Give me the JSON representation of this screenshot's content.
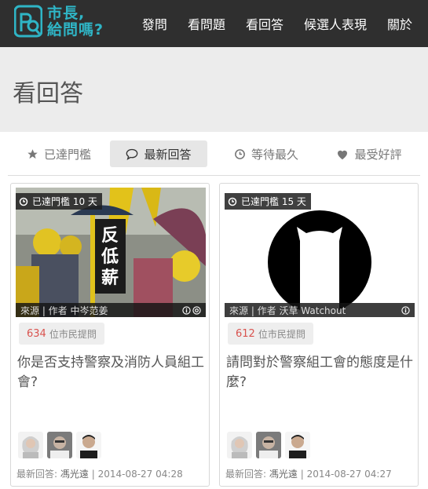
{
  "header": {
    "logo_line1": "市長,",
    "logo_line2": "給問嗎?",
    "nav": [
      "發問",
      "看問題",
      "看回答",
      "候選人表現",
      "關於"
    ]
  },
  "page_title": "看回答",
  "tabs": [
    {
      "label": "已達門檻",
      "icon": "star-icon",
      "active": false
    },
    {
      "label": "最新回答",
      "icon": "speech-bubble-icon",
      "active": true
    },
    {
      "label": "等待最久",
      "icon": "clock-icon",
      "active": false
    },
    {
      "label": "最受好評",
      "icon": "heart-icon",
      "active": false
    }
  ],
  "cards": [
    {
      "badge": "已達門檻 10 天",
      "image_sign_text": "反低薪",
      "credit": "來源 | 作者 中岑范姜",
      "count": "634",
      "count_label": "位市民提問",
      "question": "你是否支持警察及消防人員組工會?",
      "latest_label": "最新回答:",
      "latest_name": "馮光遠",
      "latest_time": "| 2014-08-27 04:28"
    },
    {
      "badge": "已達門檻 15 天",
      "credit": "來源 | 作者 沃草 Watchout",
      "count": "612",
      "count_label": "位市民提問",
      "question": "請問對於警察組工會的態度是什麼?",
      "latest_label": "最新回答:",
      "latest_name": "馮光遠",
      "latest_time": "| 2014-08-27 04:27"
    }
  ],
  "colors": {
    "header_bg": "#2f2f2f",
    "logo_accent": "#2fb5c6",
    "count_red": "#d9534f",
    "title_band": "#ececec"
  }
}
